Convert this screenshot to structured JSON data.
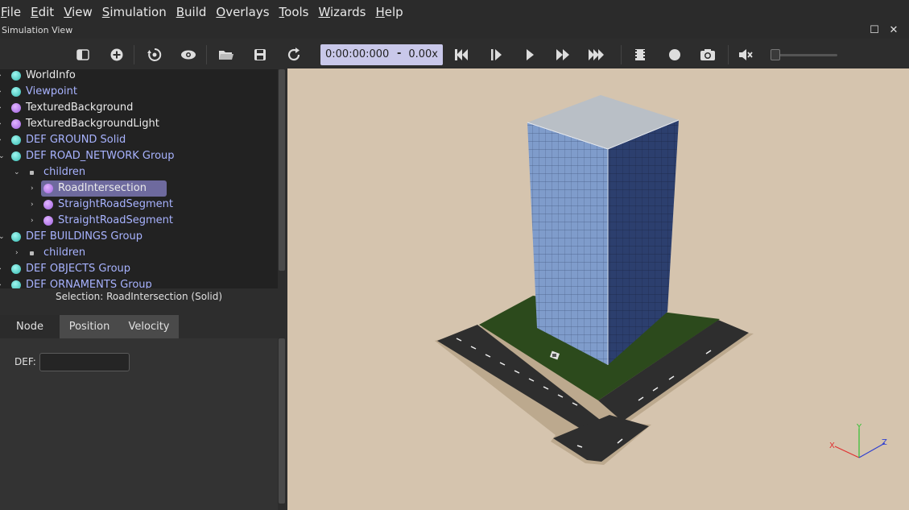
{
  "menu": [
    "File",
    "Edit",
    "View",
    "Simulation",
    "Build",
    "Overlays",
    "Tools",
    "Wizards",
    "Help"
  ],
  "view_title": "Simulation View",
  "toolbar": {
    "time": "0:00:00:000",
    "time_sep": "-",
    "speed": "0.00x"
  },
  "tree": [
    {
      "label": "WorldInfo",
      "color": "cyan",
      "text": "white"
    },
    {
      "label": "Viewpoint",
      "color": "cyan",
      "text": "blue"
    },
    {
      "label": "TexturedBackground",
      "color": "purple",
      "text": "white"
    },
    {
      "label": "TexturedBackgroundLight",
      "color": "purple",
      "text": "white"
    },
    {
      "label": "DEF GROUND Solid",
      "color": "cyan",
      "text": "blue"
    },
    {
      "label": "DEF ROAD_NETWORK Group",
      "color": "cyan",
      "text": "blue"
    },
    {
      "label": "children",
      "text": "blue"
    },
    {
      "label": "RoadIntersection",
      "color": "purple",
      "text": "white",
      "selected": true
    },
    {
      "label": "StraightRoadSegment",
      "color": "purple",
      "text": "blue"
    },
    {
      "label": "StraightRoadSegment",
      "color": "purple",
      "text": "blue"
    },
    {
      "label": "DEF BUILDINGS Group",
      "color": "cyan",
      "text": "blue"
    },
    {
      "label": "children",
      "text": "blue"
    },
    {
      "label": "DEF OBJECTS Group",
      "color": "cyan",
      "text": "blue"
    },
    {
      "label": "DEF ORNAMENTS Group",
      "color": "cyan",
      "text": "blue"
    }
  ],
  "selection": "Selection: RoadIntersection (Solid)",
  "tabs": [
    "Node",
    "Position",
    "Velocity"
  ],
  "def_label": "DEF:",
  "def_value": "",
  "axis_labels": {
    "x": "X",
    "y": "Y",
    "z": "Z"
  }
}
